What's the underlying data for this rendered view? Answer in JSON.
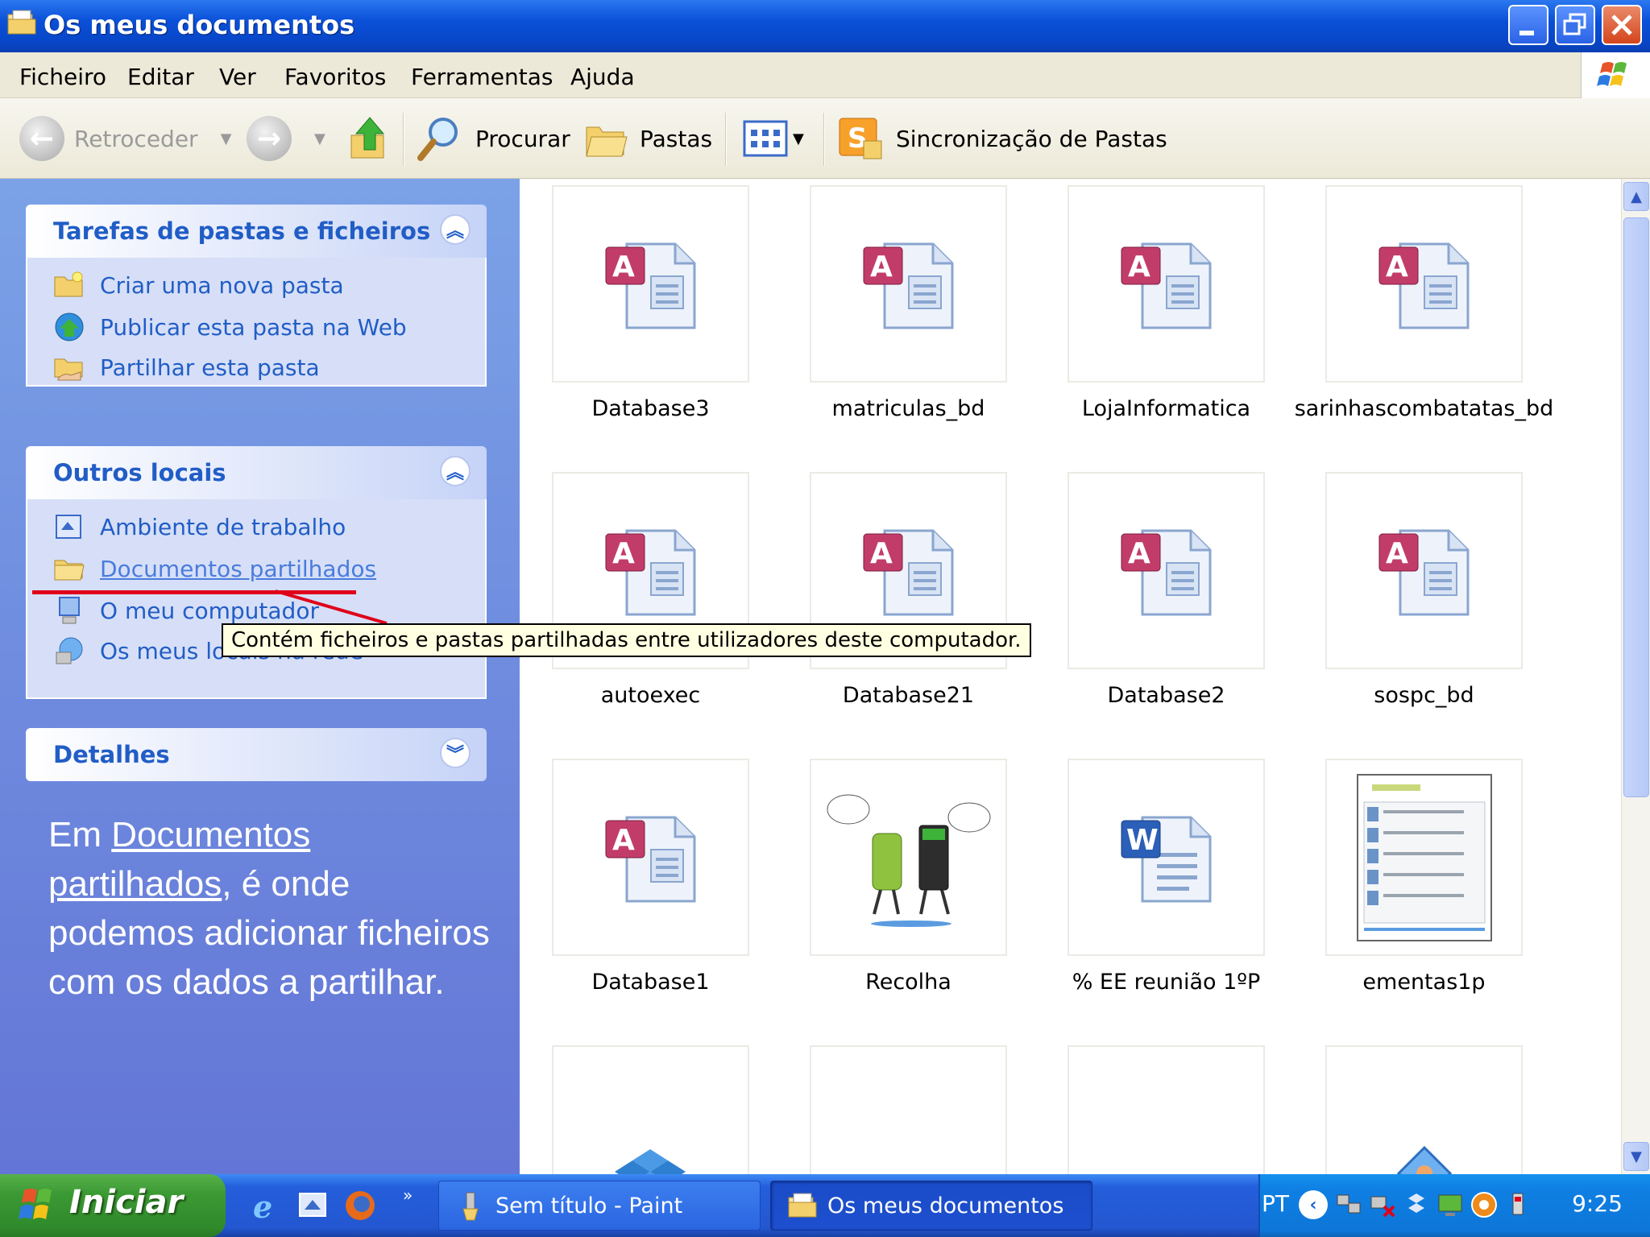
{
  "window": {
    "title": "Os meus documentos"
  },
  "menu": {
    "items": [
      "Ficheiro",
      "Editar",
      "Ver",
      "Favoritos",
      "Ferramentas",
      "Ajuda"
    ]
  },
  "toolbar": {
    "back_label": "Retroceder",
    "search_label": "Procurar",
    "folders_label": "Pastas",
    "sync_label": "Sincronização de Pastas"
  },
  "tasks_panel": {
    "title": "Tarefas de pastas e ficheiros",
    "items": [
      {
        "label": "Criar uma nova pasta",
        "icon": "new-folder-icon"
      },
      {
        "label": "Publicar esta pasta na Web",
        "icon": "publish-web-icon"
      },
      {
        "label": "Partilhar esta pasta",
        "icon": "share-folder-icon"
      }
    ]
  },
  "places_panel": {
    "title": "Outros locais",
    "items": [
      {
        "label": "Ambiente de trabalho",
        "icon": "desktop-icon"
      },
      {
        "label": "Documentos partilhados",
        "icon": "shared-folder-icon"
      },
      {
        "label": "O meu computador",
        "icon": "my-computer-icon"
      },
      {
        "label": "Os meus locais na rede",
        "icon": "network-places-icon"
      }
    ]
  },
  "details_panel": {
    "title": "Detalhes"
  },
  "explanation": {
    "prefix": "Em ",
    "link1": "Documentos",
    "link2": "partilhados",
    "suffix1": ", é onde",
    "line3": "podemos adicionar ficheiros",
    "line4": "com os dados a partilhar."
  },
  "tooltip": {
    "text": "Contém ficheiros e pastas partilhadas entre utilizadores deste computador."
  },
  "files": [
    {
      "name": "Database3",
      "type": "access"
    },
    {
      "name": "matriculas_bd",
      "type": "access"
    },
    {
      "name": "LojaInformatica",
      "type": "access"
    },
    {
      "name": "sarinhascombatatas_bd",
      "type": "access"
    },
    {
      "name": "autoexec",
      "type": "access"
    },
    {
      "name": "Database21",
      "type": "access"
    },
    {
      "name": "Database2",
      "type": "access"
    },
    {
      "name": "sospc_bd",
      "type": "access"
    },
    {
      "name": "Database1",
      "type": "access"
    },
    {
      "name": "Recolha",
      "type": "image"
    },
    {
      "name": "% EE reunião 1ºP",
      "type": "word"
    },
    {
      "name": "ementas1p",
      "type": "document-preview"
    },
    {
      "name": "",
      "type": "dropbox-folder"
    },
    {
      "name": "",
      "type": "folder"
    },
    {
      "name": "",
      "type": "folder"
    },
    {
      "name": "",
      "type": "shared-picture-folder"
    }
  ],
  "taskbar": {
    "start_label": "Iniciar",
    "tasks": [
      {
        "label": "Sem título - Paint",
        "active": false
      },
      {
        "label": "Os meus documentos",
        "active": true
      }
    ],
    "language": "PT",
    "clock": "9:25"
  },
  "colors": {
    "titlebar": "#0a50d8",
    "left_pane": "#6f8ddf",
    "link_blue": "#215dc6",
    "annotation_red": "#e0001a",
    "taskbar": "#245edb",
    "start_green": "#3c9a34"
  }
}
